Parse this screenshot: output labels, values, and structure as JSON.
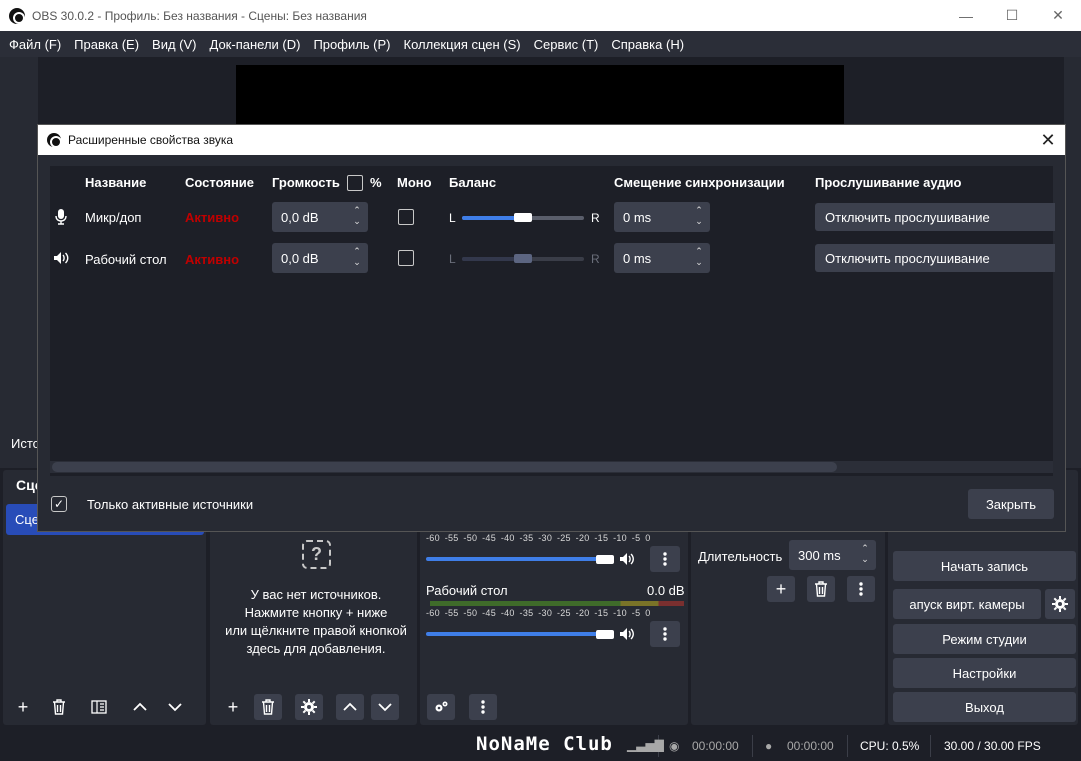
{
  "window": {
    "title": "OBS 30.0.2 - Профиль: Без названия - Сцены: Без названия",
    "minimize": "—",
    "maximize": "☐",
    "close": "✕"
  },
  "menu": [
    "Файл (F)",
    "Правка (E)",
    "Вид (V)",
    "Док-панели (D)",
    "Профиль (P)",
    "Коллекция сцен (S)",
    "Сервис (T)",
    "Справка (H)"
  ],
  "main": {
    "sources_label_partial": "Исто",
    "scenes_header_partial": "Сце",
    "scene_item_partial": "Сце",
    "sources_empty_lines": [
      "У вас нет источников.",
      "Нажмите кнопку + ниже",
      "или щёлкните правой кнопкой",
      "здесь для добавления."
    ],
    "mixer": {
      "scale": "-60 -55 -50 -45 -40 -35 -30 -25 -20 -15 -10 -5 0",
      "channels": [
        {
          "name": "",
          "db": ""
        },
        {
          "name": "Рабочий стол",
          "db": "0.0 dB"
        }
      ]
    },
    "transitions": {
      "duration_label": "Длительность",
      "duration_value": "300 ms"
    },
    "controls": {
      "start_recording": "Начать запись",
      "virtual_camera": "апуск вирт. камеры",
      "studio_mode": "Режим студии",
      "settings": "Настройки",
      "exit": "Выход"
    }
  },
  "status_bar": {
    "watermark": "NoNaMe Club",
    "stream_time": "00:00:00",
    "rec_time": "00:00:00",
    "cpu": "CPU: 0.5%",
    "fps": "30.00 / 30.00 FPS"
  },
  "dialog": {
    "title": "Расширенные свойства звука",
    "close_icon": "✕",
    "columns": {
      "name": "Название",
      "status": "Состояние",
      "volume": "Громкость",
      "percent": "%",
      "mono": "Моно",
      "balance": "Баланс",
      "sync_offset": "Смещение синхронизации",
      "monitoring": "Прослушивание аудио"
    },
    "rows": [
      {
        "icon": "microphone-icon",
        "name": "Микр/доп",
        "status": "Активно",
        "volume": "0,0 dB",
        "mono": false,
        "balance_left": "L",
        "balance_right": "R",
        "balance": 0.5,
        "enabled": true,
        "sync_offset": "0 ms",
        "monitoring": "Отключить прослушивание"
      },
      {
        "icon": "speaker-icon",
        "name": "Рабочий стол",
        "status": "Активно",
        "volume": "0,0 dB",
        "mono": false,
        "balance_left": "L",
        "balance_right": "R",
        "balance": 0.5,
        "enabled": false,
        "sync_offset": "0 ms",
        "monitoring": "Отключить прослушивание"
      }
    ],
    "only_active_label": "Только активные источники",
    "only_active_checked": true,
    "close_button": "Закрыть"
  },
  "colors": {
    "accent": "#284cb8",
    "status_active": "#c00000",
    "slider": "#3f7ee8"
  }
}
